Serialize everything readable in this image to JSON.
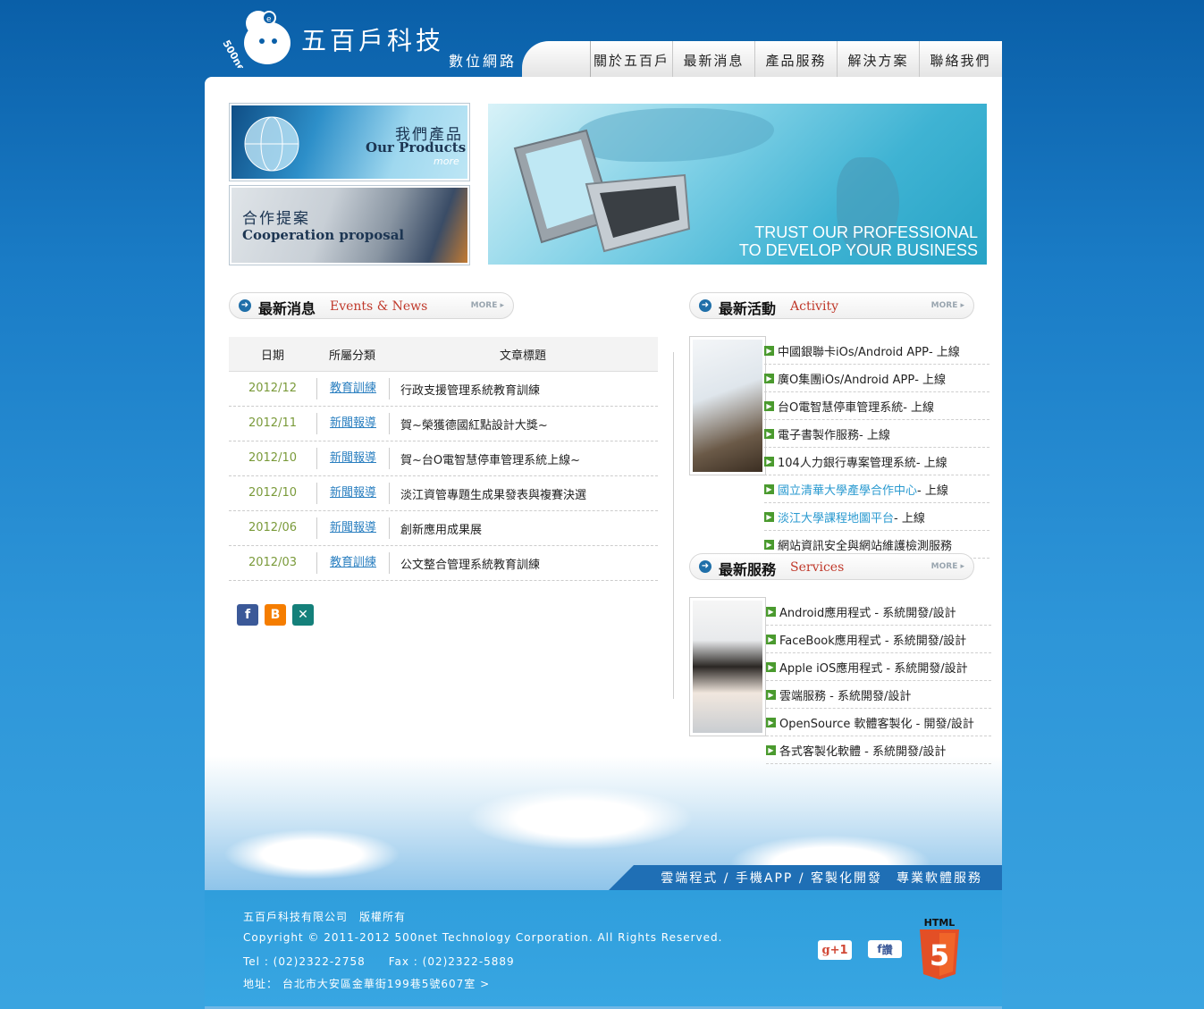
{
  "brand": {
    "name": "五百戶科技",
    "sub": "數位網路",
    "mascot_text": "500net"
  },
  "nav": [
    "關於五百戶",
    "最新消息",
    "產品服務",
    "解決方案",
    "聯絡我們"
  ],
  "promo": {
    "products": {
      "zh": "我們產品",
      "en": "Our Products",
      "more": "more"
    },
    "coop": {
      "zh": "合作提案",
      "en": "Cooperation proposal"
    }
  },
  "banner": {
    "line1": "TRUST OUR PROFESSIONAL",
    "line2": "TO DEVELOP YOUR BUSINESS"
  },
  "news": {
    "title_zh": "最新消息",
    "title_en": "Events & News",
    "more": "MORE",
    "headers": {
      "date": "日期",
      "category": "所屬分類",
      "title": "文章標題"
    },
    "rows": [
      {
        "date": "2012/12",
        "category": "教育訓練",
        "title": "行政支援管理系統教育訓練"
      },
      {
        "date": "2012/11",
        "category": "新聞報導",
        "title": "賀~榮獲德國紅點設計大獎~"
      },
      {
        "date": "2012/10",
        "category": "新聞報導",
        "title": "賀~台O電智慧停車管理系統上線~"
      },
      {
        "date": "2012/10",
        "category": "新聞報導",
        "title": "淡江資管專題生成果發表與複賽決選"
      },
      {
        "date": "2012/06",
        "category": "新聞報導",
        "title": "創新應用成果展"
      },
      {
        "date": "2012/03",
        "category": "教育訓練",
        "title": "公文整合管理系統教育訓練"
      }
    ]
  },
  "activity": {
    "title_zh": "最新活動",
    "title_en": "Activity",
    "more": "MORE",
    "items": [
      {
        "main": "中國銀聯卡iOs/Android APP",
        "suffix": " - 上線",
        "link": false
      },
      {
        "main": "廣O集團iOs/Android APP",
        "suffix": " - 上線",
        "link": false
      },
      {
        "main": "台O電智慧停車管理系統",
        "suffix": " - 上線",
        "link": false
      },
      {
        "main": "電子書製作服務",
        "suffix": " - 上線",
        "link": false
      },
      {
        "main": "104人力銀行專案管理系統",
        "suffix": " - 上線",
        "link": false
      },
      {
        "main": "國立清華大學產學合作中心",
        "suffix": " - 上線",
        "link": true
      },
      {
        "main": "淡江大學課程地圖平台",
        "suffix": " - 上線",
        "link": true
      },
      {
        "main": "網站資訊安全與網站維護檢測服務",
        "suffix": "",
        "link": false
      }
    ]
  },
  "services": {
    "title_zh": "最新服務",
    "title_en": "Services",
    "more": "MORE",
    "items": [
      "Android應用程式 - 系統開發/設計",
      "FaceBook應用程式 - 系統開發/設計",
      "Apple iOS應用程式 - 系統開發/設計",
      "雲端服務 - 系統開發/設計",
      "OpenSource 軟體客製化 - 開發/設計",
      "各式客製化軟體 - 系統開發/設計"
    ]
  },
  "slogan": "雲端程式 / 手機APP / 客製化開發　專業軟體服務",
  "footer": {
    "company": "五百戶科技有限公司　版權所有",
    "copyright": "Copyright © 2011-2012 500net Technology Corporation. All Rights Reserved.",
    "tel": "Tel : (02)2322-2758　　Fax : (02)2322-5889",
    "address": "地址：  台北市大安區金華街199巷5號607室 >",
    "gplus": "+1",
    "fb": "讚",
    "html5_label": "HTML",
    "html5_num": "5"
  },
  "colors": {
    "brand_blue": "#1f6fb5",
    "news_red": "#c0392b",
    "date_green": "#7a9a3a",
    "link_blue": "#2a7fc0"
  }
}
